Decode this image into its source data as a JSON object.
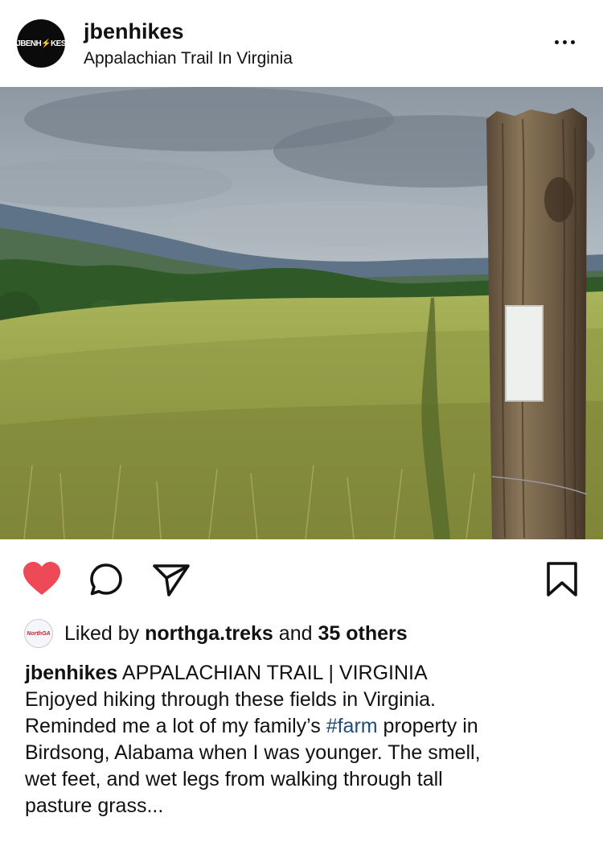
{
  "post": {
    "avatar_text": "JBENH⚡KES",
    "username": "jbenhikes",
    "location": "Appalachian Trail In Virginia"
  },
  "likes": {
    "prefix": "Liked by",
    "user": "northga.treks",
    "connector": "and",
    "others": "35 others",
    "avatar_text": "NorthGA"
  },
  "caption": {
    "username": "jbenhikes",
    "title": "APPALACHIAN TRAIL | VIRGINIA",
    "line1": "Enjoyed hiking through these fields in Virginia.",
    "line2_before": "Reminded me a lot of my family’s",
    "hashtag": "#farm",
    "line2_after": "property in",
    "line3": "Birdsong, Alabama when I was younger. The smell,",
    "line4": "wet feet, and wet legs from walking through tall",
    "line5": "pasture grass..."
  },
  "icons": {
    "like": "heart-icon",
    "comment": "comment-icon",
    "share": "send-icon",
    "save": "bookmark-icon",
    "more": "more-icon"
  },
  "colors": {
    "like": "#ed4956",
    "hashtag": "#1f4b7a"
  }
}
